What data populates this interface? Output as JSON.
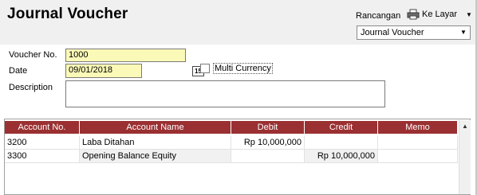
{
  "header": {
    "title": "Journal Voucher",
    "rancangan_label": "Rancangan",
    "ke_layar_label": "Ke Layar",
    "rancangan_value": "Journal Voucher"
  },
  "form": {
    "voucher_no_label": "Voucher No.",
    "voucher_no_value": "1000",
    "date_label": "Date",
    "date_value": "09/01/2018",
    "date_button": "15",
    "multi_currency_label": "Multi Currency",
    "multi_currency_checked": false,
    "description_label": "Description",
    "description_value": ""
  },
  "grid": {
    "columns": [
      "Account No.",
      "Account Name",
      "Debit",
      "Credit",
      "Memo"
    ],
    "rows": [
      {
        "account_no": "3200",
        "account_name": "Laba Ditahan",
        "debit": "Rp 10,000,000",
        "credit": "",
        "memo": ""
      },
      {
        "account_no": "3300",
        "account_name": "Opening Balance Equity",
        "debit": "",
        "credit": "Rp 10,000,000",
        "memo": ""
      }
    ]
  },
  "colors": {
    "grid_header": "#9a3032",
    "input_highlight": "#fbf9b7",
    "panel_background": "#f0f0f0"
  }
}
